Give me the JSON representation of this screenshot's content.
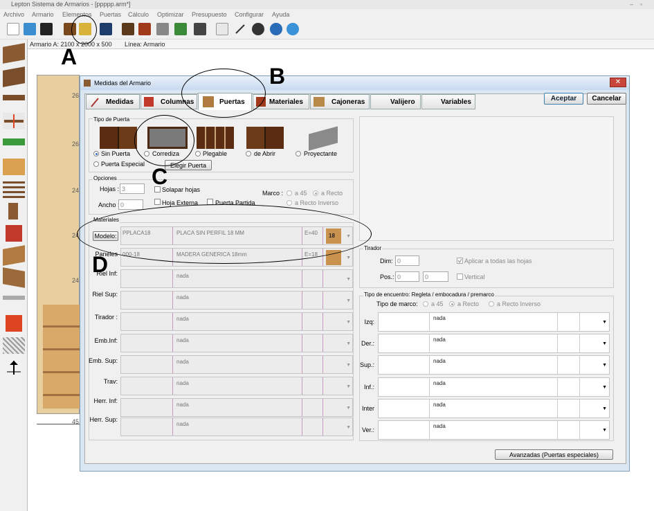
{
  "window": {
    "title": "Lepton Sistema de Armarios - [ppppp.arm*]"
  },
  "menu": [
    "Archivo",
    "Armario",
    "Elementos",
    "Puertas",
    "Cálculo",
    "Optimizar",
    "Presupuesto",
    "Configurar",
    "Ayuda"
  ],
  "status": {
    "armario": "Armario A: 2100 x 2000 x 500",
    "linea": "Línea: Armario"
  },
  "background_labels": [
    "26",
    "26",
    "24",
    "24",
    "24",
    "45"
  ],
  "annotations": {
    "a": "A",
    "b": "B",
    "c": "C",
    "d": "D"
  },
  "dialog": {
    "title": "Medidas del Armario",
    "close": "✕",
    "tabs": [
      "Medidas",
      "Columnas",
      "Puertas",
      "Materiales",
      "Cajoneras",
      "Valijero",
      "Variables"
    ],
    "accept": "Aceptar",
    "cancel": "Cancelar",
    "tipo_puerta": {
      "title": "Tipo de Puerta",
      "options": [
        "Sin Puerta",
        "Corrediza",
        "Plegable",
        "de Abrir",
        "Proyectante",
        "Puerta Especial"
      ],
      "elegir": "Elegir Puerta"
    },
    "opciones": {
      "title": "Opciones",
      "hojas_label": "Hojas :",
      "hojas_value": "3",
      "ancho_label": "Ancho :",
      "ancho_value": "0",
      "solapar": "Solapar hojas",
      "hoja_externa": "Hoja Externa",
      "puerta_partida": "Puerta Partida",
      "marco_label": "Marco :",
      "marco_a45": "a 45",
      "marco_recto": "a Recto",
      "marco_recto_inverso": "a Recto Inverso"
    },
    "materiales": {
      "title": "Materiales",
      "modelo_button": "Modelo:",
      "rows": [
        {
          "label": "",
          "code": "PPLACA18",
          "desc": "PLACA SIN PERFIL 18 MM",
          "extra": "E=40",
          "thumb": "18"
        },
        {
          "label": "Paneles",
          "code": "000-18",
          "desc": "MADERA GENERICA 18mm",
          "extra": "E=18",
          "thumb": ""
        },
        {
          "label": "Riel Inf:",
          "code": "",
          "desc": "nada",
          "extra": "",
          "thumb": ""
        },
        {
          "label": "Riel Sup:",
          "code": "",
          "desc": "nada",
          "extra": "",
          "thumb": ""
        },
        {
          "label": "Tirador :",
          "code": "",
          "desc": "nada",
          "extra": "",
          "thumb": ""
        },
        {
          "label": "Emb.Inf:",
          "code": "",
          "desc": "nada",
          "extra": "",
          "thumb": ""
        },
        {
          "label": "Emb. Sup:",
          "code": "",
          "desc": "nada",
          "extra": "",
          "thumb": ""
        },
        {
          "label": "Trav:",
          "code": "",
          "desc": "nada",
          "extra": "",
          "thumb": ""
        },
        {
          "label": "Herr. Inf:",
          "code": "",
          "desc": "nada",
          "extra": "",
          "thumb": ""
        },
        {
          "label": "Herr. Sup:",
          "code": "",
          "desc": "nada",
          "extra": "",
          "thumb": ""
        }
      ]
    },
    "tirador": {
      "title": "Tirador",
      "dim_label": "Dim:",
      "dim_value": "0",
      "pos_label": "Pos.:",
      "pos_value1": "0",
      "pos_value2": "0",
      "aplicar": "Aplicar a todas las hojas",
      "vertical": "Vertical"
    },
    "encuentro": {
      "title": "Tipo de encuentro: Regleta / embocadura / premarco",
      "tipo_marco_label": "Tipo de marco:",
      "a45": "a 45",
      "recto": "a Recto",
      "recto_inverso": "a Recto Inverso",
      "rows": [
        {
          "label": "Izq:",
          "value": "nada"
        },
        {
          "label": "Der.:",
          "value": "nada"
        },
        {
          "label": "Sup.:",
          "value": "nada"
        },
        {
          "label": "Inf.:",
          "value": "nada"
        },
        {
          "label": "Inter",
          "value": "nada"
        },
        {
          "label": "Ver.:",
          "value": "nada"
        }
      ]
    },
    "avanzadas": "Avanzadas (Puertas especiales)"
  }
}
